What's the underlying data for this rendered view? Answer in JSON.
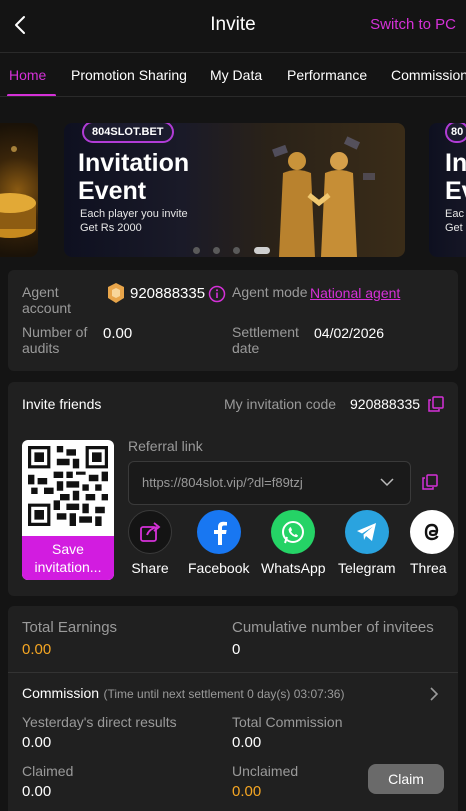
{
  "header": {
    "title": "Invite",
    "switch_label": "Switch to PC"
  },
  "tabs": [
    {
      "label": "Home"
    },
    {
      "label": "Promotion Sharing"
    },
    {
      "label": "My Data"
    },
    {
      "label": "Performance"
    },
    {
      "label": "Commission"
    }
  ],
  "banner": {
    "brand": "804SLOT.BET",
    "title_line1": "Invitation",
    "title_line2": "Event",
    "sub_line1": "Each player you invite",
    "sub_line2": "Get Rs 2000",
    "right_brand": "80",
    "right_title1": "In",
    "right_title2": "Ev",
    "right_sub1": "Eac",
    "right_sub2": "Get",
    "slide_count": 5,
    "active_slide": 4
  },
  "agent": {
    "account_label": "Agent account",
    "account_value": "920888335",
    "mode_label": "Agent mode",
    "mode_value": "National agent",
    "audits_label": "Number of audits",
    "audits_value": "0.00",
    "settlement_label": "Settlement date",
    "settlement_value": "04/02/2026"
  },
  "invite": {
    "title": "Invite friends",
    "code_label": "My invitation code",
    "code_value": "920888335",
    "referral_label": "Referral link",
    "referral_value": "https://804slot.vip/?dl=f89tzj",
    "save_label_1": "Save",
    "save_label_2": "invitation...",
    "share_items": [
      {
        "label": "Share",
        "icon": "share-icon"
      },
      {
        "label": "Facebook",
        "icon": "facebook-icon"
      },
      {
        "label": "WhatsApp",
        "icon": "whatsapp-icon"
      },
      {
        "label": "Telegram",
        "icon": "telegram-icon"
      },
      {
        "label": "Threa",
        "icon": "threads-icon"
      }
    ]
  },
  "earnings": {
    "total_label": "Total Earnings",
    "total_value": "0.00",
    "invitees_label": "Cumulative number of invitees",
    "invitees_value": "0",
    "commission_title": "Commission",
    "commission_note": "(Time until next settlement  0 day(s) 03:07:36)",
    "yesterday_label": "Yesterday's direct results",
    "yesterday_value": "0.00",
    "total_commission_label": "Total Commission",
    "total_commission_value": "0.00",
    "claimed_label": "Claimed",
    "claimed_value": "0.00",
    "unclaimed_label": "Unclaimed",
    "unclaimed_value": "0.00",
    "claim_button": "Claim"
  },
  "colors": {
    "accent": "#d531d8",
    "orange": "#f5a623",
    "background": "#141414",
    "card": "#202020"
  }
}
